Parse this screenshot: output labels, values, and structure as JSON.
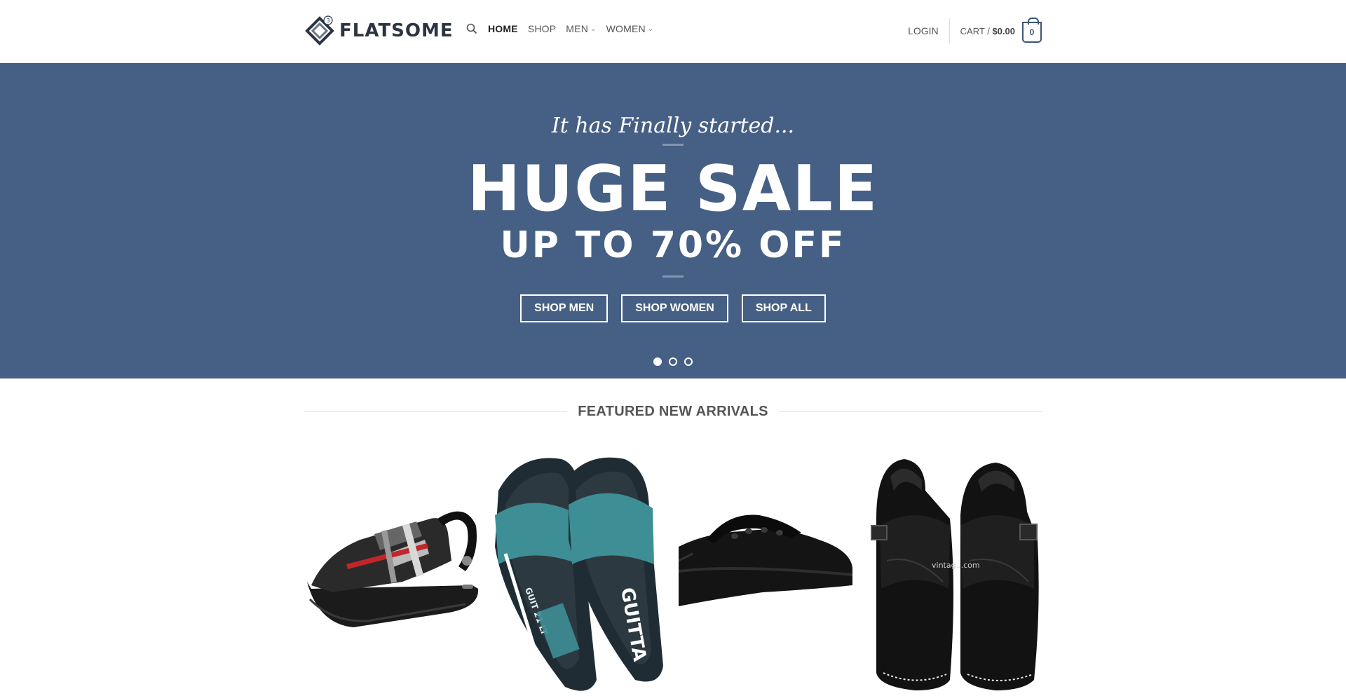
{
  "header": {
    "logo_text": "FLATSOME",
    "logo_badge": "3",
    "nav": [
      {
        "label": "HOME",
        "active": true,
        "dropdown": false
      },
      {
        "label": "SHOP",
        "active": false,
        "dropdown": false
      },
      {
        "label": "MEN",
        "active": false,
        "dropdown": true
      },
      {
        "label": "WOMEN",
        "active": false,
        "dropdown": true
      }
    ],
    "login_label": "LOGIN",
    "cart_label": "CART /",
    "cart_amount": "$0.00",
    "cart_count": "0"
  },
  "hero": {
    "tagline": "It has Finally started...",
    "title": "HUGE SALE",
    "subtitle": "UP TO 70% OFF",
    "buttons": [
      "SHOP MEN",
      "SHOP WOMEN",
      "SHOP ALL"
    ],
    "background_color": "#465f84",
    "slides_total": 3,
    "active_slide": 1
  },
  "section": {
    "title": "FEATURED NEW ARRIVALS"
  },
  "products": [
    {
      "image": "black-plaid-sandal"
    },
    {
      "image": "teal-slide-sandals",
      "print": "GUITTA"
    },
    {
      "image": "black-flip-flop"
    },
    {
      "image": "black-leather-peshawari-sandals",
      "watermark": "vintag...com"
    }
  ],
  "colors": {
    "accent": "#465f84",
    "cart_badge": "#3d5578",
    "logo_text": "#2b3440"
  }
}
